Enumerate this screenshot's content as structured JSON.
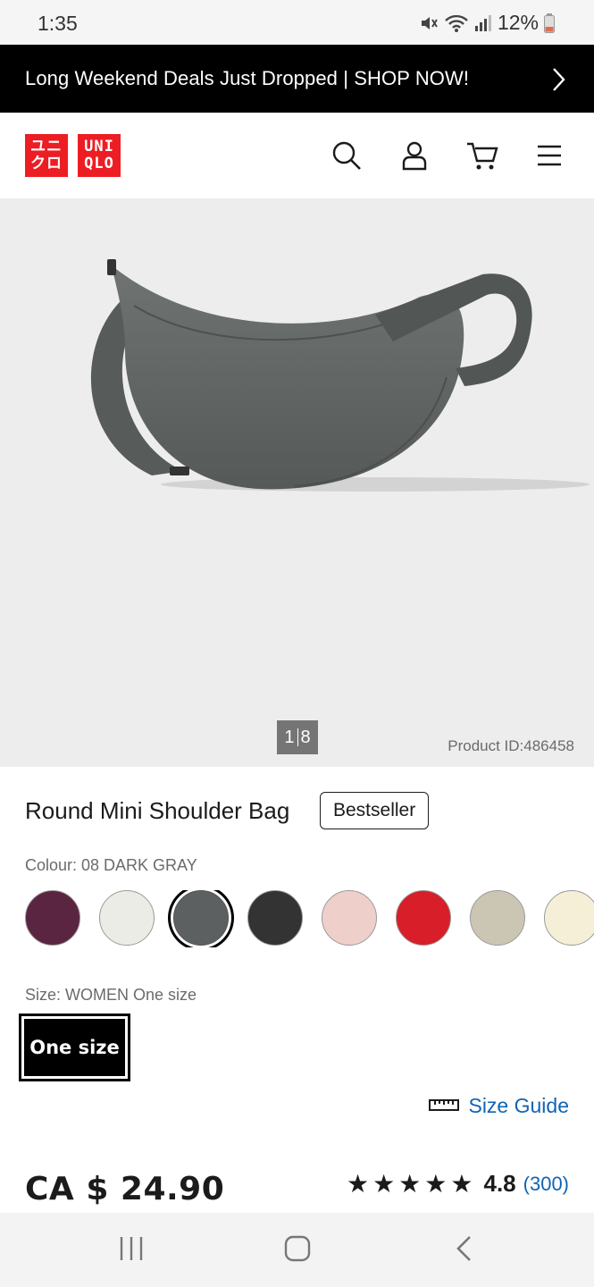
{
  "status_bar": {
    "time": "1:35",
    "battery": "12%"
  },
  "promo": {
    "text": "Long Weekend Deals Just Dropped | SHOP NOW!"
  },
  "header": {
    "logo_left": [
      "ユニ",
      "クロ"
    ],
    "logo_right": [
      "UNI",
      "QLO"
    ],
    "icons": [
      "search-icon",
      "account-icon",
      "cart-icon",
      "menu-icon"
    ]
  },
  "gallery": {
    "page_current": "1",
    "page_total": "8",
    "product_id": "Product ID:486458"
  },
  "product": {
    "title": "Round Mini Shoulder Bag",
    "badge": "Bestseller",
    "colour_label": "Colour: 08 DARK GRAY",
    "colours": [
      "#5a2540",
      "#ecece6",
      "#5d6060",
      "#333333",
      "#efcfc9",
      "#d81e28",
      "#cbc6b3",
      "#f6efd7"
    ],
    "selected_colour_index": 2,
    "size_label": "Size: WOMEN One size",
    "size_option": "One size",
    "size_guide": "Size Guide",
    "price": "CA $ 24.90",
    "stars": "★★★★★",
    "rating": "4.8",
    "rating_count": "(300)"
  },
  "colors": {
    "brand_red": "#ed1d24",
    "link_blue": "#1064b3"
  }
}
